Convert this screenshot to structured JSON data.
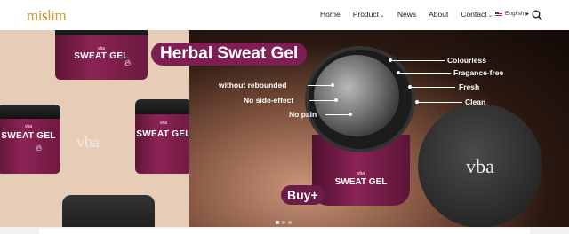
{
  "header": {
    "logo_main": "mi",
    "logo_leaf": "s",
    "logo_rest": "lim",
    "nav": [
      {
        "label": "Home",
        "has_dropdown": false
      },
      {
        "label": "Product",
        "has_dropdown": true
      },
      {
        "label": "News",
        "has_dropdown": false
      },
      {
        "label": "About",
        "has_dropdown": false
      },
      {
        "label": "Contact",
        "has_dropdown": true
      }
    ],
    "language": "English",
    "search_icon": "search-icon"
  },
  "hero": {
    "headline": "Herbal Sweat Gel",
    "jar_brand": "vba",
    "jar_name": "SWEAT GEL",
    "lid_logo": "vba",
    "watermark": "vba",
    "features_left": [
      "without rebounded",
      "No side-effect",
      "No pain"
    ],
    "features_right": [
      "Colourless",
      "Fragance-free",
      "Fresh",
      "Clean"
    ],
    "cta": "Buy",
    "cta_icon": "plus-icon",
    "slides_count": 3,
    "active_slide": 1
  },
  "colors": {
    "accent": "#7d1f52",
    "logo": "#d19a3a",
    "hero_left_bg": "#e7cdb8"
  }
}
